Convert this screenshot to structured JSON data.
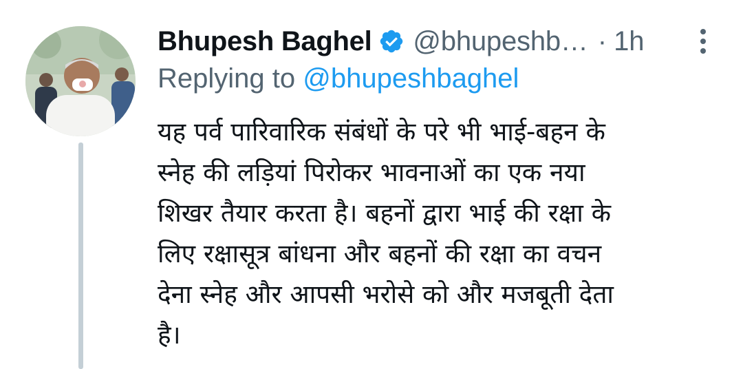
{
  "tweet": {
    "display_name": "Bhupesh Baghel",
    "handle": "@bhupeshb…",
    "separator": "·",
    "time": "1h",
    "replying_prefix": "Replying to ",
    "replying_handle": "@bhupeshbaghel",
    "text": "यह पर्व पारिवारिक संबंधों के परे भी भाई-बहन के\nस्नेह की लड़ियां पिरोकर भावनाओं का एक नया\nशिखर तैयार करता है। बहनों द्वारा भाई की रक्षा के\nलिए रक्षासूत्र बांधना और बहनों की रक्षा का वचन\nदेना स्नेह और आपसी भरोसे को और मजबूती देता\nहै।"
  },
  "icons": {
    "verified": "verified-badge-icon",
    "more": "more-vertical-icon"
  },
  "colors": {
    "text_primary": "#0f1419",
    "text_secondary": "#536471",
    "accent": "#1d9bf0",
    "thread_line": "#c4cfd6"
  }
}
